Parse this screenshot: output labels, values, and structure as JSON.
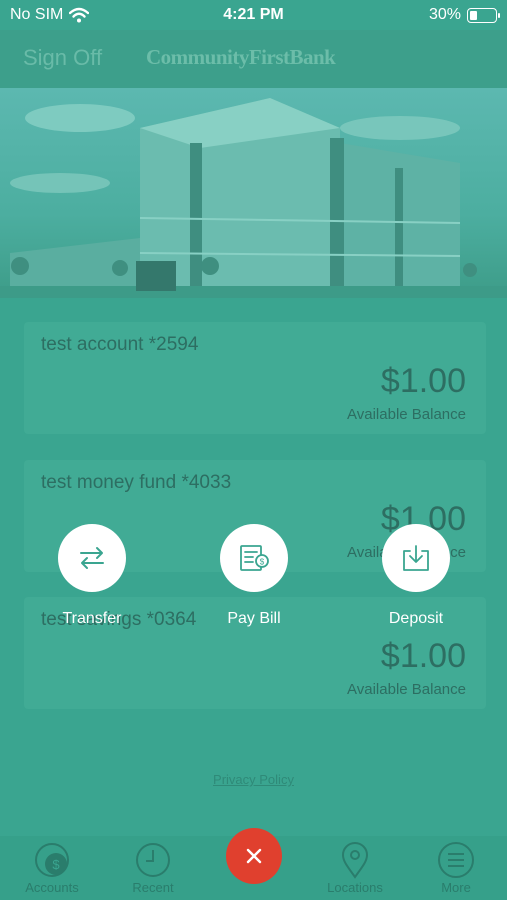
{
  "status_bar": {
    "carrier": "No SIM",
    "time": "4:21 PM",
    "battery": "30%",
    "battery_level": 0.3
  },
  "header": {
    "signoff_label": "Sign Off",
    "bank_name": "CommunityFirstBank"
  },
  "accounts": [
    {
      "name": "test account *2594",
      "balance": "$1.00",
      "balance_label": "Available Balance"
    },
    {
      "name": "test money fund *4033",
      "balance": "$1.00",
      "balance_label": "Available Balance"
    },
    {
      "name": "test savings *0364",
      "balance": "$1.00",
      "balance_label": "Available Balance"
    }
  ],
  "privacy_link": "Privacy Policy",
  "quick_actions": [
    {
      "label": "Transfer",
      "icon": "transfer-arrows-icon"
    },
    {
      "label": "Pay Bill",
      "icon": "bill-icon"
    },
    {
      "label": "Deposit",
      "icon": "download-tray-icon"
    }
  ],
  "tab_bar": {
    "tabs": [
      {
        "label": "Accounts",
        "icon": "dollar-icon"
      },
      {
        "label": "Recent",
        "icon": "clock-icon"
      },
      {
        "label": "Locations",
        "icon": "pin-icon"
      },
      {
        "label": "More",
        "icon": "menu-icon"
      }
    ],
    "close_icon": "close-icon"
  },
  "colors": {
    "background": "#3aa590",
    "close_button": "#e0402e"
  }
}
